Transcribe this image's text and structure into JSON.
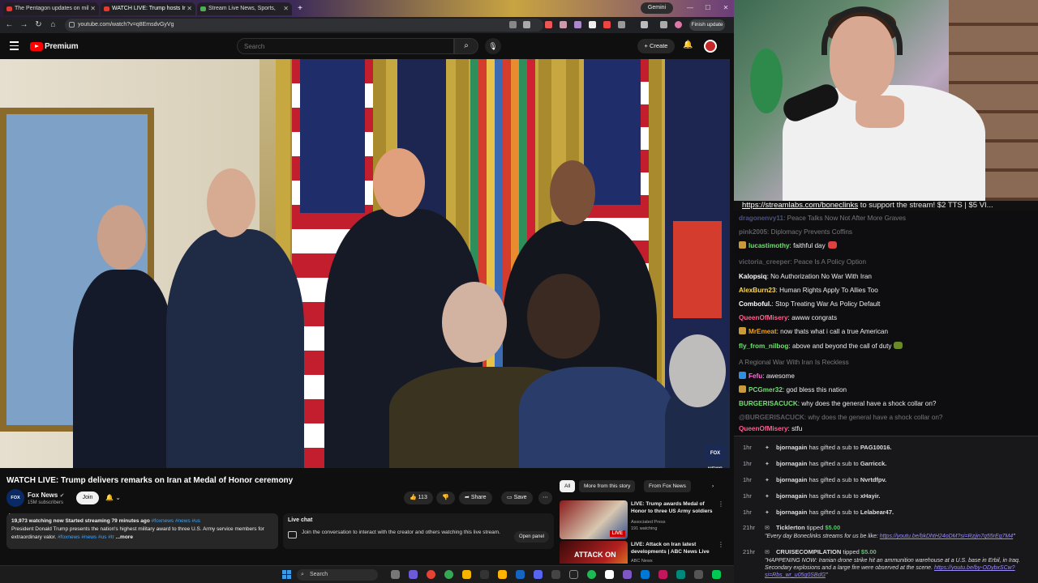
{
  "browser": {
    "tabs": [
      {
        "label": "The Pentagon updates on mil"
      },
      {
        "label": "WATCH LIVE: Trump hosts Ir"
      },
      {
        "label": "Stream Live News, Sports, "
      }
    ],
    "gemini_label": "Gemini",
    "url": "youtube.com/watch?v=q8EmsdvGyVg",
    "finish_update_label": "Finish update"
  },
  "youtube": {
    "brand": "Premium",
    "search_placeholder": "Search",
    "create_label": "Create",
    "video_title": "WATCH LIVE: Trump delivers remarks on Iran at Medal of Honor ceremony",
    "channel_logo_text": "FOX NEWS",
    "channel_name": "Fox News",
    "subscribers": "15M subscribers",
    "join_label": "Join",
    "likes": "113",
    "share_label": "Share",
    "save_label": "Save",
    "video_bug": "FOX NEWS",
    "description": {
      "meta": "19,973 watching now  Started streaming 79 minutes ago",
      "meta_tags": "#foxnews #news #us",
      "text": "President Donald Trump presents the nation's highest military award to three U.S. Army service members for extraordinary valor.",
      "text_tags": "#foxnews #news #us #tr",
      "more": "...more"
    },
    "live_chat": {
      "title": "Live chat",
      "body": "Join the conversation to interact with the creator and others watching this live stream.",
      "open_panel": "Open panel"
    },
    "chips": [
      "All",
      "More from this story",
      "From Fox News"
    ],
    "related": [
      {
        "title": "LIVE: Trump awards Medal of Honor to three US Army soldiers",
        "channel": "Associated Press",
        "meta": "191 watching",
        "thumb_text": "LIVE"
      },
      {
        "title": "LIVE: Attack on Iran latest developments | ABC News Live",
        "channel": "ABC News",
        "meta": "",
        "thumb_text": "ATTACK ON"
      }
    ]
  },
  "taskbar": {
    "search_placeholder": "Search"
  },
  "stream": {
    "banner_link": "https://streamlabs.com/boneclinks",
    "banner_text": " to support the stream! $2 TTS | $5 VI..."
  },
  "chat_messages": [
    {
      "user": "dragonenvy11",
      "text": "Peace Talks Now Not After More Graves",
      "color": "#9aa0ff",
      "dim": true
    },
    {
      "user": "pink2005",
      "text": "Diplomacy Prevents Coffins",
      "color": "#b9b9c6",
      "dim": true
    },
    {
      "user": "lucastimothy",
      "text": "faithful day",
      "color": "#6ee06e",
      "dim": false
    },
    {
      "user": "victoria_creeper",
      "text": "Peace Is A Policy Option",
      "color": "#b9b9c6",
      "dim": true
    },
    {
      "user": "Kalopsiq",
      "text": "No Authorization No War With Iran",
      "color": "#ffffff",
      "dim": false
    },
    {
      "user": "AlexBurn23",
      "text": "Human Rights Apply To Allies Too",
      "color": "#ffd94a",
      "dim": false
    },
    {
      "user": "Comboful.",
      "text": "Stop Treating War As Policy Default",
      "color": "#ffffff",
      "dim": false
    },
    {
      "user": "QueenOfMisery",
      "text": "awww congrats",
      "color": "#ff5f8f",
      "dim": false
    },
    {
      "user": "MrEmeat",
      "text": "now thats what i call a true American",
      "color": "#f0a020",
      "dim": false
    },
    {
      "user": "fly_from_nilbog",
      "text": "above and beyond the call of duty",
      "color": "#6ee06e",
      "dim": false
    },
    {
      "user": "",
      "text": "A Regional War With Iran Is Reckless",
      "color": "#ff4040",
      "dim": true
    },
    {
      "user": "Fefu",
      "text": "awesome",
      "color": "#ff6ad5",
      "dim": false
    },
    {
      "user": "PCGmer32",
      "text": "god bless this nation",
      "color": "#6ee06e",
      "dim": false
    },
    {
      "user": "BURGERISACUCK",
      "text": "why does the general have a shock collar on?",
      "color": "#6ee06e",
      "dim": false
    },
    {
      "user": "@BURGERISACUCK",
      "text": "why does the general have a shock collar on?",
      "color": "#b9b9c6",
      "dim": true
    },
    {
      "user": "QueenOfMisery",
      "text": "stfu",
      "color": "#ff5f8f",
      "dim": false
    }
  ],
  "events": [
    {
      "time": "1hr",
      "user": "bjornagain",
      "action": "has gifted a sub to",
      "target": "PAG10016."
    },
    {
      "time": "1hr",
      "user": "bjornagain",
      "action": "has gifted a sub to",
      "target": "Garricck."
    },
    {
      "time": "1hr",
      "user": "bjornagain",
      "action": "has gifted a sub to",
      "target": "Nvrtdfpv."
    },
    {
      "time": "1hr",
      "user": "bjornagain",
      "action": "has gifted a sub to",
      "target": "xHayir."
    },
    {
      "time": "1hr",
      "user": "bjornagain",
      "action": "has gifted a sub to",
      "target": "Lelabear47."
    }
  ],
  "tips": [
    {
      "time": "21hr",
      "user": "Ticklerton",
      "action": "tipped",
      "amount": "$5.00",
      "message": "\"Every day Boneclinks streams for us be like: ",
      "link": "https://youtu.be/bkDhtH24oDM?si=Rzjin7q55rEg7M4",
      "after": "\""
    },
    {
      "time": "21hr",
      "user": "CRUISECOMPILATION",
      "action": "tipped",
      "amount": "$5.00",
      "message_line1": "\"HAPPENING NOW: Iranian drone strike hit an ammunition warehouse at a U.S. base in Erbil, in Iraq.",
      "message_line2": "Secondary explosions and a large fire were observed at the scene. ",
      "link": "https://youtu.be/by-ODybxSCw?",
      "message_line3_link": "si=Rbs_wr_u05g0SBdG",
      "after": "\""
    }
  ],
  "colors": {
    "youtube_red": "#ff0000",
    "chat_bg": "#0e0e10",
    "link": "#3ea6ff",
    "tip_green": "#45d55a"
  }
}
